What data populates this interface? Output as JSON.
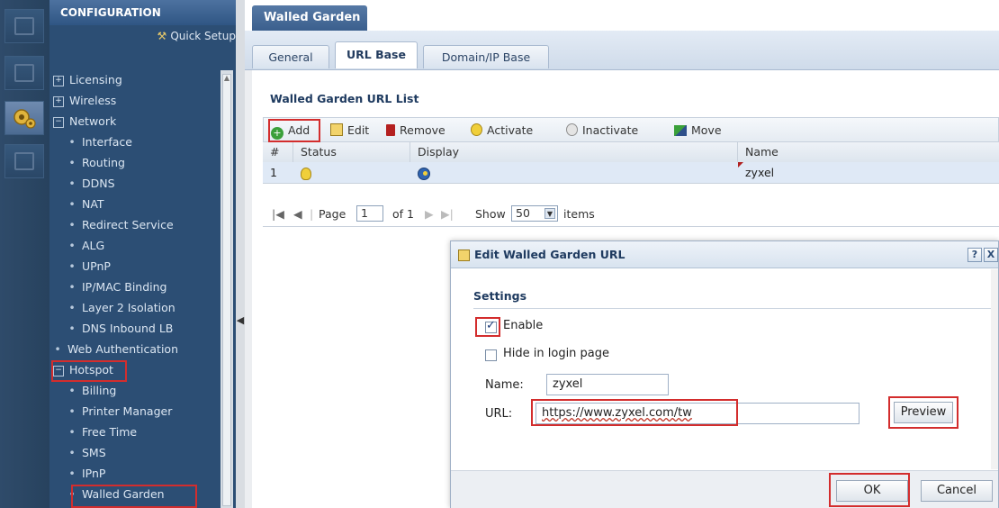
{
  "sidebar": {
    "header": "CONFIGURATION",
    "quick_setup": "Quick Setup",
    "items": [
      {
        "label": "Licensing",
        "kind": "top",
        "expand": "+"
      },
      {
        "label": "Wireless",
        "kind": "top",
        "expand": "+"
      },
      {
        "label": "Network",
        "kind": "top",
        "expand": "−"
      },
      {
        "label": "Interface",
        "kind": "sub"
      },
      {
        "label": "Routing",
        "kind": "sub"
      },
      {
        "label": "DDNS",
        "kind": "sub"
      },
      {
        "label": "NAT",
        "kind": "sub"
      },
      {
        "label": "Redirect Service",
        "kind": "sub"
      },
      {
        "label": "ALG",
        "kind": "sub"
      },
      {
        "label": "UPnP",
        "kind": "sub"
      },
      {
        "label": "IP/MAC Binding",
        "kind": "sub"
      },
      {
        "label": "Layer 2 Isolation",
        "kind": "sub"
      },
      {
        "label": "DNS Inbound LB",
        "kind": "sub"
      },
      {
        "label": "Web Authentication",
        "kind": "top-dot"
      },
      {
        "label": "Hotspot",
        "kind": "top",
        "expand": "−"
      },
      {
        "label": "Billing",
        "kind": "sub"
      },
      {
        "label": "Printer Manager",
        "kind": "sub"
      },
      {
        "label": "Free Time",
        "kind": "sub"
      },
      {
        "label": "SMS",
        "kind": "sub"
      },
      {
        "label": "IPnP",
        "kind": "sub"
      },
      {
        "label": "Walled Garden",
        "kind": "sub"
      }
    ]
  },
  "main": {
    "page_tab": "Walled Garden",
    "sub_tabs": [
      "General",
      "URL Base",
      "Domain/IP Base"
    ],
    "active_sub_tab": "URL Base",
    "list_title": "Walled Garden URL List",
    "toolbar": {
      "add": "Add",
      "edit": "Edit",
      "remove": "Remove",
      "activate": "Activate",
      "inactivate": "Inactivate",
      "move": "Move"
    },
    "table": {
      "columns": [
        "#",
        "Status",
        "Display",
        "Name"
      ],
      "rows": [
        {
          "index": "1",
          "status": "bulb-on-icon",
          "display": "display-icon",
          "name": "zyxel"
        }
      ]
    },
    "pager": {
      "page_label": "Page",
      "page_value": "1",
      "of_label": "of 1",
      "show_label": "Show",
      "show_value": "50",
      "items_label": "items"
    }
  },
  "dialog": {
    "title": "Edit Walled Garden URL",
    "help": "?",
    "close": "X",
    "section": "Settings",
    "enable_label": "Enable",
    "enable_checked": true,
    "hide_label": "Hide in login page",
    "hide_checked": false,
    "name_label": "Name:",
    "name_value": "zyxel",
    "url_label": "URL:",
    "url_value": "https://www.zyxel.com/tw",
    "preview": "Preview",
    "ok": "OK",
    "cancel": "Cancel"
  },
  "colors": {
    "sidebar_bg": "#2c4e74",
    "tab_bg": "#3b5f8d",
    "highlight_red": "#d32d2d"
  }
}
